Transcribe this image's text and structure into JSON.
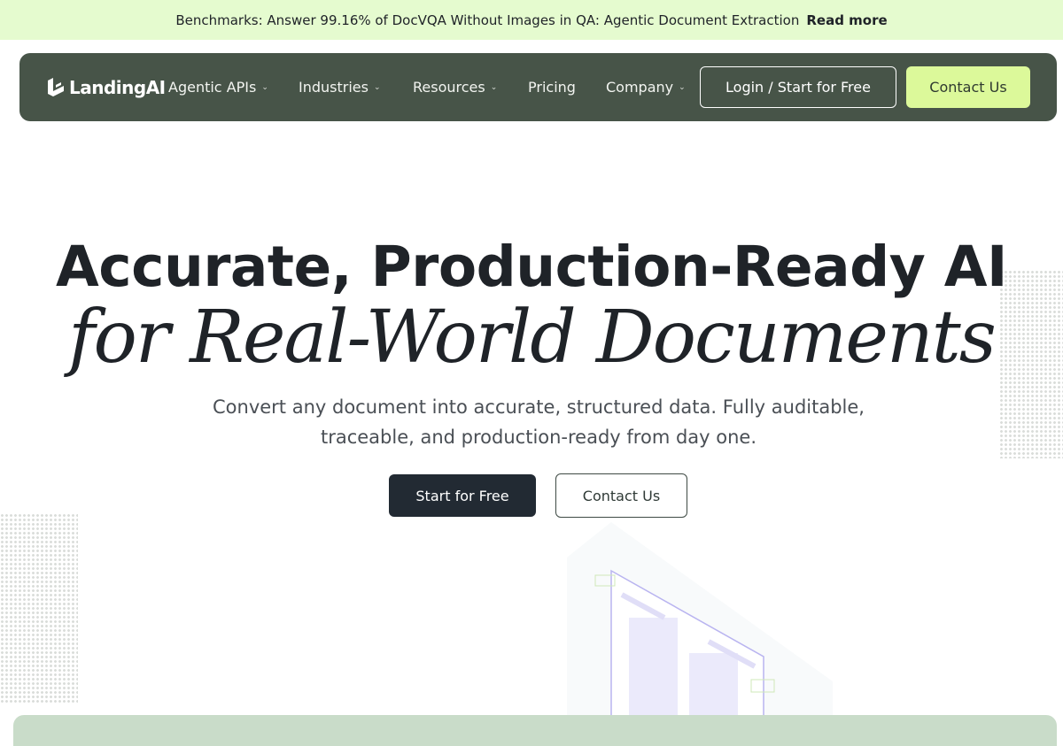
{
  "announcement": {
    "text": "Benchmarks: Answer 99.16% of DocVQA Without Images in QA: Agentic Document Extraction",
    "link": "Read more"
  },
  "nav": {
    "logo": "LandingAI",
    "items": [
      {
        "label": "Agentic APIs",
        "dropdown": true
      },
      {
        "label": "Industries",
        "dropdown": true
      },
      {
        "label": "Resources",
        "dropdown": true
      },
      {
        "label": "Pricing",
        "dropdown": false
      },
      {
        "label": "Company",
        "dropdown": true
      }
    ],
    "login_label": "Login / Start for Free",
    "contact_label": "Contact Us"
  },
  "hero": {
    "title": "Accurate, Production-Ready AI",
    "subtitle": "for Real-World Documents",
    "description": "Convert any document into accurate, structured data. Fully auditable, traceable, and production-ready from day one.",
    "primary_cta": "Start for Free",
    "secondary_cta": "Contact Us"
  },
  "colors": {
    "announcement_bg": "#e5fbcf",
    "nav_bg": "#475448",
    "accent": "#dcf99a",
    "primary_button": "#222a33",
    "panel": "#c9dcc9"
  },
  "icons": {
    "logo": "stacked-blocks-logo-icon",
    "dropdown": "chevron-down-icon"
  }
}
